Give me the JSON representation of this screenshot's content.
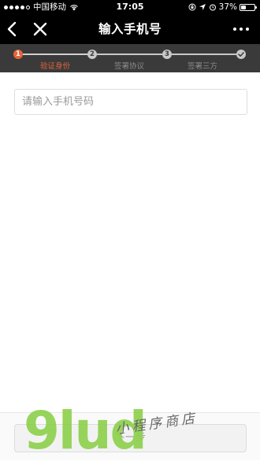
{
  "status_bar": {
    "carrier": "中国移动",
    "time": "17:05",
    "battery": "37%",
    "battery_level": 0.37,
    "icons": [
      "signal-dots-icon",
      "wifi-icon",
      "screen-lock-icon",
      "location-icon",
      "alarm-icon",
      "battery-icon"
    ]
  },
  "nav": {
    "title": "输入手机号",
    "icons": [
      "back-chevron-icon",
      "close-icon",
      "more-dots-icon"
    ]
  },
  "steps": {
    "current_step": 1,
    "items": [
      {
        "number": "1",
        "label": "验证身份",
        "state": "active"
      },
      {
        "number": "2",
        "label": "签署协议",
        "state": "pending"
      },
      {
        "number": "3",
        "label": "签署三方",
        "state": "pending"
      },
      {
        "number": "",
        "label": "",
        "state": "done-check"
      }
    ],
    "accent_color": "#e8643a",
    "pending_color": "#c8c8c8",
    "bar_background": "#3a3a3a"
  },
  "form": {
    "phone_input": {
      "value": "",
      "placeholder": "请输入手机号码"
    }
  },
  "bottom": {
    "next_label": "下一步"
  },
  "watermark": {
    "logo_text": "9lud",
    "tagline": "小程序商店",
    "logo_color": "#8fd14f"
  }
}
